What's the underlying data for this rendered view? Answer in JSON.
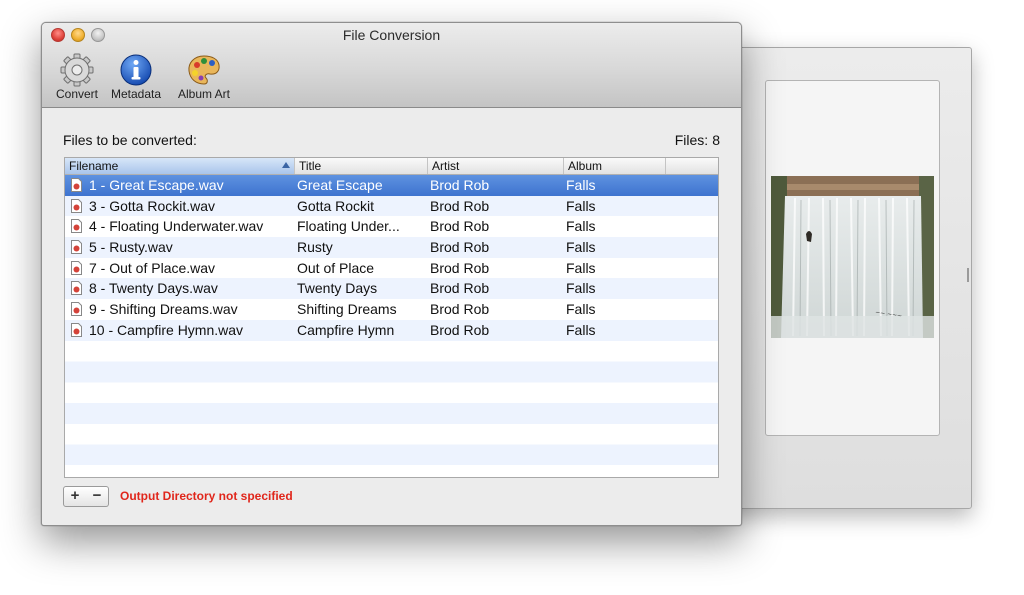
{
  "window": {
    "title": "File Conversion"
  },
  "toolbar": [
    {
      "label": "Convert",
      "icon": "gear-icon"
    },
    {
      "label": "Metadata",
      "icon": "info-icon"
    },
    {
      "label": "Album Art",
      "icon": "palette-icon"
    }
  ],
  "files_section": {
    "label": "Files to be converted:",
    "count_label": "Files:",
    "count": "8"
  },
  "table": {
    "columns": [
      "Filename",
      "Title",
      "Artist",
      "Album"
    ],
    "sorted_column": "Filename",
    "rows": [
      {
        "filename": "1 - Great Escape.wav",
        "title": "Great Escape",
        "artist": "Brod Rob",
        "album": "Falls",
        "selected": true
      },
      {
        "filename": "3 - Gotta Rockit.wav",
        "title": "Gotta Rockit",
        "artist": "Brod Rob",
        "album": "Falls"
      },
      {
        "filename": "4 - Floating Underwater.wav",
        "title": "Floating Under...",
        "artist": "Brod Rob",
        "album": "Falls"
      },
      {
        "filename": "5 - Rusty.wav",
        "title": "Rusty",
        "artist": "Brod Rob",
        "album": "Falls"
      },
      {
        "filename": "7 - Out of Place.wav",
        "title": "Out of Place",
        "artist": "Brod Rob",
        "album": "Falls"
      },
      {
        "filename": "8 - Twenty Days.wav",
        "title": "Twenty Days",
        "artist": "Brod Rob",
        "album": "Falls"
      },
      {
        "filename": "9 - Shifting Dreams.wav",
        "title": "Shifting Dreams",
        "artist": "Brod Rob",
        "album": "Falls"
      },
      {
        "filename": "10 - Campfire Hymn.wav",
        "title": "Campfire Hymn",
        "artist": "Brod Rob",
        "album": "Falls"
      }
    ]
  },
  "bottom_bar": {
    "add_label": "+",
    "remove_label": "−",
    "status": "Output Directory not specified",
    "status_color": "#e0261b"
  },
  "drawer": {
    "image": "waterfall album art"
  }
}
